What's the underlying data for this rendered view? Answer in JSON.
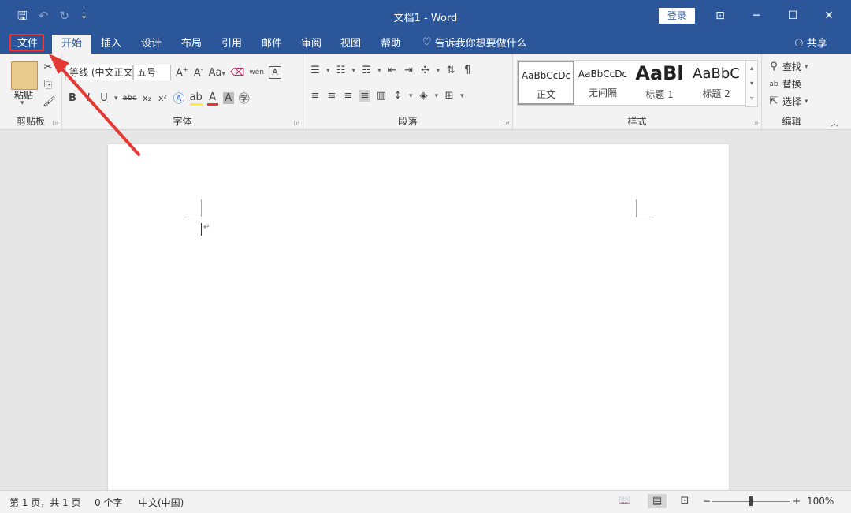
{
  "titlebar": {
    "document_title": "文档1  -  Word",
    "login_label": "登录",
    "qat_icons": [
      "save-icon",
      "undo-icon",
      "redo-icon",
      "customize-qat-icon"
    ]
  },
  "tabs": [
    {
      "label": "文件"
    },
    {
      "label": "开始"
    },
    {
      "label": "插入"
    },
    {
      "label": "设计"
    },
    {
      "label": "布局"
    },
    {
      "label": "引用"
    },
    {
      "label": "邮件"
    },
    {
      "label": "审阅"
    },
    {
      "label": "视图"
    },
    {
      "label": "帮助"
    }
  ],
  "tell_me": "告诉我你想要做什么",
  "share_label": "共享",
  "ribbon": {
    "clipboard": {
      "label": "剪贴板",
      "paste_label": "粘贴"
    },
    "font": {
      "label": "字体",
      "font_name": "等线 (中文正文",
      "font_size": "五号",
      "change_case": "Aa",
      "phonetic": "wén"
    },
    "paragraph": {
      "label": "段落"
    },
    "styles": {
      "label": "样式",
      "items": [
        {
          "sample": "AaBbCcDc",
          "name": "正文"
        },
        {
          "sample": "AaBbCcDc",
          "name": "无间隔"
        },
        {
          "sample": "AaBl",
          "name": "标题 1"
        },
        {
          "sample": "AaBbC",
          "name": "标题 2"
        }
      ]
    },
    "editing": {
      "label": "编辑",
      "find": "查找",
      "replace": "替换",
      "select": "选择"
    }
  },
  "status": {
    "page": "第 1 页，共 1 页",
    "words": "0 个字",
    "language": "中文(中国)",
    "zoom": "100%",
    "zoom_level_percent": 100
  },
  "colors": {
    "titlebar": "#2b579a",
    "highlight_box": "#e33333",
    "arrow": "#e53935"
  }
}
